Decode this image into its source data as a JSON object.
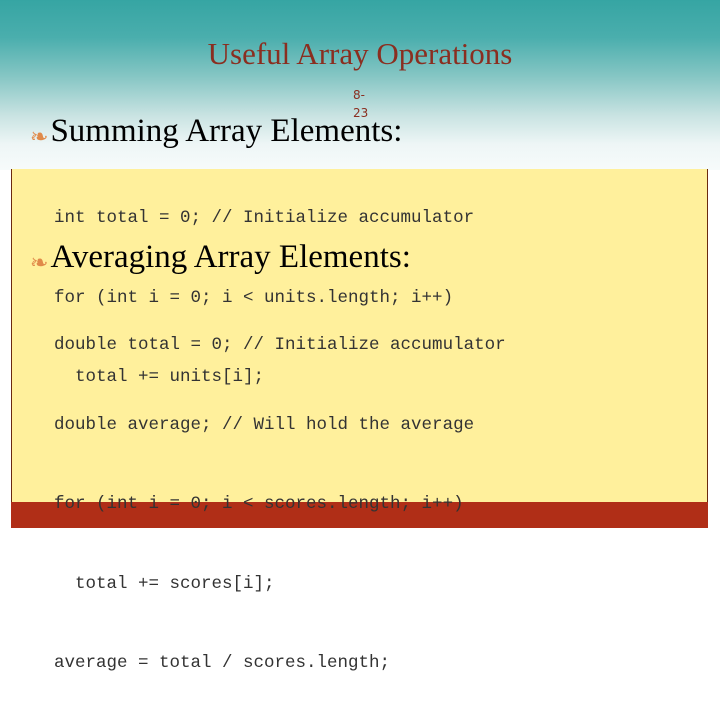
{
  "slide": {
    "title": "Useful Array Operations",
    "page_number_line1": "8-",
    "page_number_line2": "23",
    "sections": [
      {
        "heading": "Summing Array Elements:",
        "bullet_icon": "ornament-bullet",
        "code_lines": [
          "int total = 0; // Initialize accumulator",
          "for (int i = 0; i < units.length; i++)",
          "  total += units[i];"
        ]
      },
      {
        "heading": "Averaging Array Elements:",
        "bullet_icon": "ornament-bullet",
        "code_lines": [
          "double total = 0; // Initialize accumulator",
          "double average; // Will hold the average",
          "for (int i = 0; i < scores.length; i++)",
          "  total += scores[i];",
          "average = total / scores.length;"
        ]
      }
    ]
  },
  "colors": {
    "header_teal": "#36a5a3",
    "title_color": "#8a2e20",
    "content_yellow": "#fff09c",
    "footer_red": "#b02e17",
    "bullet_orange": "#e08a4a"
  }
}
